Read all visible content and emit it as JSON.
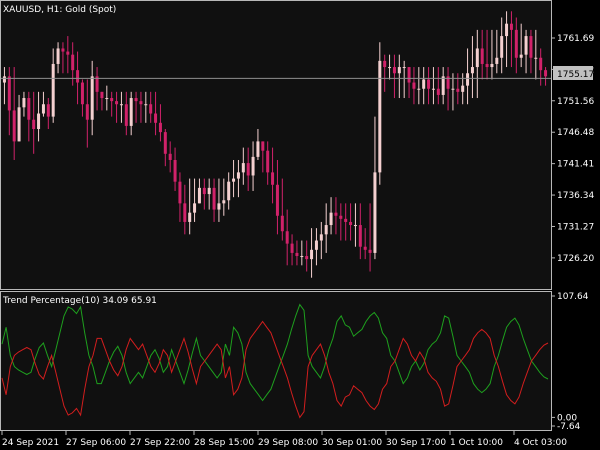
{
  "main_header": {
    "symbol": "XAUUSD",
    "timeframe": "H1:",
    "description": "Gold (Spot)"
  },
  "indicator_header": {
    "name": "Trend Percentage(10)",
    "value1": "34.09",
    "value2": "65.91"
  },
  "current_price": "1755.17",
  "colors": {
    "bull": "#f4d0d0",
    "bear": "#d1226a",
    "bg": "#000000",
    "pane": "#101010",
    "axis": "#b8b8b8",
    "green_line": "#1ea01e",
    "red_line": "#d21e1e",
    "price_line": "#8f8f8f"
  },
  "chart_data": [
    {
      "type": "candlestick",
      "y_ticks": [
        "1761.69",
        "1756.62",
        "1751.56",
        "1746.48",
        "1741.41",
        "1736.34",
        "1731.27",
        "1726.20"
      ],
      "ylim": [
        1721.5,
        1767.5
      ],
      "current_price": 1755.17,
      "close": [
        1755.5,
        1750,
        1745,
        1750.5,
        1752,
        1748.5,
        1747,
        1749.5,
        1751,
        1749,
        1757.5,
        1760,
        1759.5,
        1759,
        1756.5,
        1754.5,
        1751,
        1748.5,
        1755.5,
        1753,
        1752,
        1752,
        1751.5,
        1751,
        1751,
        1747.5,
        1752,
        1751.5,
        1751,
        1751,
        1749.5,
        1748,
        1746.5,
        1743,
        1742,
        1738.5,
        1735,
        1732,
        1733.5,
        1735,
        1737.5,
        1736.5,
        1737.5,
        1734,
        1735,
        1735.5,
        1738.5,
        1739,
        1740,
        1741.5,
        1739.5,
        1742.5,
        1745,
        1743.5,
        1740,
        1738,
        1733,
        1730.5,
        1728.5,
        1727,
        1726.5,
        1726.5,
        1726,
        1727.5,
        1729,
        1730,
        1731.5,
        1733.5,
        1733,
        1732.5,
        1732,
        1731.5,
        1731.5,
        1728,
        1727.5,
        1727,
        1740,
        1758,
        1757,
        1757,
        1756,
        1757,
        1757,
        1754.5,
        1753.5,
        1753.5,
        1755,
        1753.5,
        1753.5,
        1752.5,
        1755.5,
        1753.5,
        1753.5,
        1753,
        1754,
        1756,
        1757,
        1760,
        1757.5,
        1757,
        1757.5,
        1758.5,
        1762,
        1764,
        1763,
        1758.5,
        1759,
        1762,
        1758.5,
        1758.5,
        1756.5,
        1755.5
      ],
      "high": [
        1757,
        1757,
        1757,
        1752.5,
        1753,
        1753,
        1753,
        1753,
        1753,
        1752,
        1760,
        1761,
        1761,
        1762,
        1761,
        1759.5,
        1755,
        1755,
        1758,
        1757,
        1753,
        1754,
        1753,
        1753,
        1753,
        1753,
        1753,
        1753,
        1753,
        1753,
        1753,
        1753,
        1751,
        1747,
        1745,
        1744,
        1740,
        1738,
        1739,
        1739,
        1739,
        1739,
        1739,
        1739,
        1739,
        1739,
        1740,
        1742,
        1742,
        1744,
        1744,
        1745,
        1747,
        1745,
        1745,
        1744,
        1742,
        1739,
        1734,
        1730,
        1729,
        1729,
        1729,
        1731,
        1731,
        1732,
        1735,
        1736,
        1736,
        1735,
        1735,
        1735,
        1735,
        1735,
        1731,
        1735,
        1749,
        1761,
        1759,
        1759,
        1759,
        1759,
        1758,
        1757,
        1757,
        1757,
        1757,
        1757,
        1757,
        1757,
        1757,
        1757,
        1756,
        1756,
        1756,
        1760,
        1762,
        1763,
        1763,
        1763,
        1763,
        1763,
        1765,
        1766,
        1766,
        1765,
        1764,
        1763,
        1763,
        1763,
        1760,
        1757
      ],
      "low": [
        1751,
        1746,
        1742,
        1745,
        1749,
        1745,
        1743,
        1745,
        1749,
        1747,
        1748,
        1756,
        1756,
        1756,
        1754,
        1751,
        1749,
        1744,
        1746,
        1750,
        1750,
        1750,
        1749,
        1748,
        1748,
        1746,
        1746,
        1748,
        1748,
        1748,
        1748,
        1746,
        1745,
        1741,
        1740,
        1737,
        1732,
        1730,
        1730,
        1732,
        1735,
        1734,
        1734,
        1732,
        1732,
        1733,
        1734,
        1736,
        1736,
        1738,
        1737,
        1737,
        1742,
        1740,
        1738,
        1735,
        1730,
        1729,
        1725,
        1725,
        1725,
        1725,
        1724,
        1723,
        1725,
        1726,
        1727,
        1730,
        1730,
        1729,
        1729,
        1729,
        1728,
        1726,
        1726,
        1724,
        1726,
        1738,
        1753,
        1755,
        1752,
        1752,
        1752,
        1752,
        1751,
        1751,
        1751,
        1751,
        1751,
        1751,
        1751,
        1750,
        1750,
        1751,
        1751,
        1751,
        1752,
        1752,
        1755,
        1755,
        1755,
        1756,
        1756,
        1757,
        1757,
        1756,
        1757,
        1756,
        1756,
        1755,
        1754,
        1754,
        1753
      ]
    },
    {
      "type": "line",
      "y_ticks": [
        "107.64",
        "0.00",
        "-7.64"
      ],
      "ylim": [
        -7.64,
        107.64
      ],
      "series": [
        {
          "color": "#1ea01e",
          "values": [
            65,
            80,
            55,
            45,
            42,
            40,
            38,
            40,
            52,
            62,
            66,
            55,
            45,
            60,
            75,
            90,
            98,
            96,
            92,
            98,
            75,
            55,
            45,
            30,
            30,
            40,
            50,
            58,
            63,
            55,
            40,
            30,
            35,
            40,
            35,
            45,
            55,
            60,
            52,
            40,
            45,
            60,
            50,
            40,
            30,
            42,
            57,
            70,
            55,
            50,
            45,
            40,
            35,
            40,
            65,
            55,
            80,
            75,
            65,
            40,
            30,
            25,
            20,
            15,
            20,
            25,
            35,
            45,
            55,
            65,
            78,
            90,
            100,
            95,
            55,
            45,
            40,
            35,
            45,
            60,
            70,
            85,
            90,
            82,
            80,
            72,
            75,
            78,
            85,
            90,
            93,
            88,
            75,
            70,
            55,
            50,
            40,
            30,
            35,
            45,
            50,
            42,
            48,
            60,
            65,
            68,
            75,
            90,
            88,
            72,
            55,
            50,
            45,
            40,
            30,
            25,
            22,
            25,
            30,
            45,
            55,
            68,
            80,
            85,
            88,
            82,
            70,
            60,
            50,
            45,
            40,
            36,
            34
          ]
        },
        {
          "color": "#d21e1e",
          "values": [
            35,
            20,
            45,
            55,
            58,
            60,
            62,
            60,
            48,
            38,
            34,
            45,
            55,
            40,
            25,
            10,
            2,
            4,
            8,
            2,
            25,
            45,
            55,
            70,
            70,
            60,
            50,
            42,
            37,
            45,
            60,
            70,
            65,
            60,
            65,
            55,
            45,
            40,
            48,
            60,
            55,
            40,
            50,
            60,
            70,
            58,
            43,
            30,
            45,
            50,
            55,
            60,
            65,
            60,
            35,
            45,
            20,
            25,
            35,
            60,
            70,
            75,
            80,
            85,
            80,
            75,
            65,
            55,
            45,
            35,
            22,
            10,
            0,
            5,
            45,
            55,
            60,
            65,
            55,
            40,
            30,
            15,
            10,
            18,
            20,
            28,
            25,
            22,
            15,
            10,
            7,
            12,
            25,
            30,
            45,
            50,
            60,
            70,
            65,
            55,
            50,
            58,
            52,
            40,
            35,
            32,
            25,
            10,
            12,
            28,
            45,
            50,
            55,
            60,
            70,
            75,
            78,
            75,
            70,
            55,
            45,
            32,
            20,
            15,
            12,
            18,
            30,
            40,
            50,
            55,
            60,
            64,
            66
          ]
        }
      ]
    }
  ],
  "x_axis_labels": [
    "24 Sep 2021",
    "27 Sep 06:00",
    "27 Sep 22:00",
    "28 Sep 15:00",
    "29 Sep 08:00",
    "30 Sep 01:00",
    "30 Sep 17:00",
    "1 Oct 10:00",
    "4 Oct 03:00"
  ]
}
